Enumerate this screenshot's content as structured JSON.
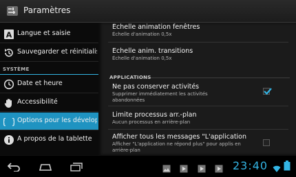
{
  "action_bar": {
    "title": "Paramètres",
    "icon": "settings-app-icon"
  },
  "sidebar": {
    "items_top": [
      {
        "label": "Langue et saisie",
        "icon": "keyboard-a-icon"
      },
      {
        "label": "Sauvegarder et réinitialis",
        "icon": "backup-reset-icon"
      }
    ],
    "section_label": "SYSTÈME",
    "items_system": [
      {
        "label": "Date et heure",
        "icon": "clock-icon"
      },
      {
        "label": "Accessibilité",
        "icon": "hand-icon"
      },
      {
        "label": "Options pour les développ",
        "icon": "braces-icon",
        "selected": true
      },
      {
        "label": "À propos de la tablette",
        "icon": "info-icon"
      }
    ]
  },
  "detail": {
    "items_top": [
      {
        "title": "Échelle animation fenêtres",
        "summary": "Échelle d'animation 0,5x"
      },
      {
        "title": "Échelle anim. transitions",
        "summary": "Échelle d'animation 0,5x"
      }
    ],
    "section_label": "APPLICATIONS",
    "items_apps": [
      {
        "title": "Ne pas conserver activités",
        "summary": "Supprimer immédiatement les activités abandonnées",
        "checked": true
      },
      {
        "title": "Limite processus arr.-plan",
        "summary": "Aucun processus en arrière-plan"
      },
      {
        "title": "Afficher tous les messages \"L'application",
        "summary": "Afficher \"L'application ne répond plus\" pour applis en arrière-plan",
        "checked": false
      }
    ]
  },
  "status_bar": {
    "time": "23:40",
    "accent_color": "#33b5e5",
    "nav_icons": [
      "back-icon",
      "home-icon",
      "recent-apps-icon"
    ],
    "notification_icons": [
      "gallery-icon",
      "media-icon",
      "media-icon",
      "media-icon",
      "media-icon"
    ]
  }
}
